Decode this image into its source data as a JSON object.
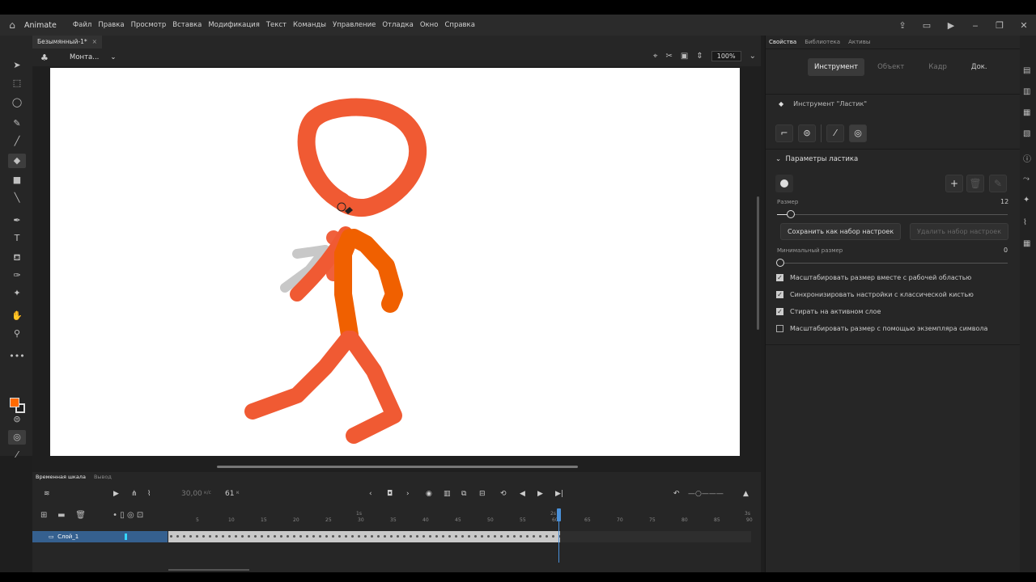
{
  "app": {
    "name": "Animate"
  },
  "menu": [
    "Файл",
    "Правка",
    "Просмотр",
    "Вставка",
    "Модификация",
    "Текст",
    "Команды",
    "Управление",
    "Отладка",
    "Окно",
    "Справка"
  ],
  "document": {
    "tab": "Безымянный-1*"
  },
  "stage_toolbar": {
    "scene": "Монта...",
    "zoom": "100%"
  },
  "colors": {
    "fill": "#ff6a00",
    "stroke": "#1e1e1e",
    "stroke_drawing": "#f05a33",
    "body_drawing": "#f06000",
    "accent": "#4a90d9"
  },
  "properties": {
    "panel_tabs": [
      "Свойства",
      "Библиотека",
      "Активы"
    ],
    "mode_tabs": [
      "Инструмент",
      "Объект",
      "Кадр",
      "Док."
    ],
    "tool_name": "Инструмент \"Ластик\"",
    "section": "Параметры ластика",
    "size_label": "Размер",
    "size_value": "12",
    "size_fraction": 0.06,
    "save_preset": "Сохранить как набор настроек",
    "delete_preset": "Удалить набор настроек",
    "min_size_label": "Минимальный размер",
    "min_size_value": "0",
    "checkboxes": [
      {
        "label": "Масштабировать размер вместе с рабочей областью",
        "checked": true
      },
      {
        "label": "Синхронизировать настройки с классической кистью",
        "checked": true
      },
      {
        "label": "Стирать на активном слое",
        "checked": true
      },
      {
        "label": "Масштабировать размер с помощью экземпляра символа",
        "checked": false
      }
    ]
  },
  "timeline": {
    "tabs": [
      "Временная шкала",
      "Вывод"
    ],
    "fps": "30,00",
    "fps_unit": "к/с",
    "frame": "61",
    "frame_unit": "к",
    "ruler_labels": [
      "1s",
      "2s",
      "3s"
    ],
    "ruler_numbers": [
      "5",
      "10",
      "15",
      "20",
      "25",
      "30",
      "35",
      "40",
      "45",
      "50",
      "55",
      "60",
      "65",
      "70",
      "75",
      "80",
      "85",
      "90"
    ],
    "layer_name": "Слой_1",
    "total_frames": 61
  }
}
